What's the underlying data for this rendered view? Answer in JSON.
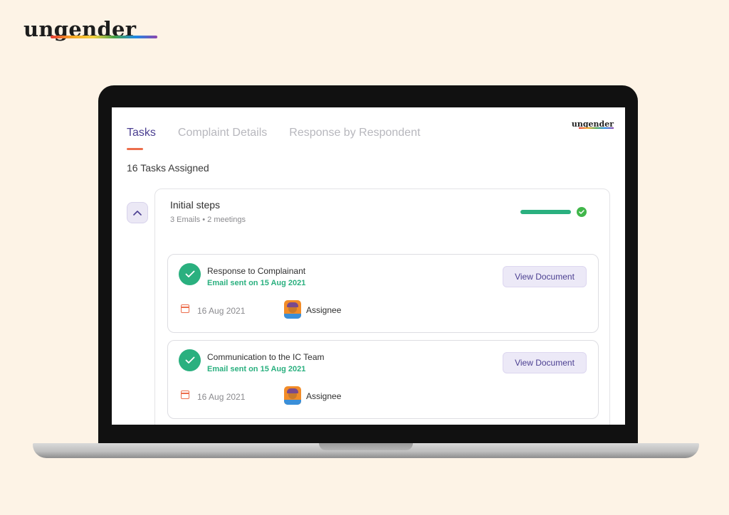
{
  "brand": {
    "name": "ungender"
  },
  "app": {
    "logo": "ungender",
    "tabs": [
      {
        "label": "Tasks",
        "active": true
      },
      {
        "label": "Complaint Details",
        "active": false
      },
      {
        "label": "Response by Respondent",
        "active": false
      }
    ],
    "task_count": "16 Tasks Assigned",
    "group": {
      "title": "Initial steps",
      "subtitle": "3 Emails • 2 meetings",
      "progress": 1.0,
      "tasks": [
        {
          "title": "Response to Complainant",
          "status": "Email sent on 15 Aug 2021",
          "button": "View Document",
          "date": "16 Aug 2021",
          "assignee": "Assignee"
        },
        {
          "title": "Communication to the IC Team",
          "status": "Email sent on 15 Aug 2021",
          "button": "View Document",
          "date": "16 Aug 2021",
          "assignee": "Assignee"
        }
      ]
    }
  },
  "colors": {
    "background": "#fdf3e6",
    "accent": "#4b3f91",
    "tab_indicator": "#ec6e4c",
    "success": "#2ab07f"
  },
  "icons": [
    "chevron-up-icon",
    "check-icon",
    "calendar-icon",
    "avatar"
  ]
}
